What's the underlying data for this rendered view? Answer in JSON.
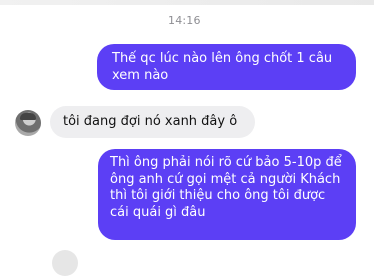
{
  "chat": {
    "timestamp": "14:16",
    "messages": [
      {
        "direction": "outgoing",
        "text": "Thế qc lúc nào lên ông chốt 1 câu xem nào"
      },
      {
        "direction": "incoming",
        "text": "tôi đang đợi nó xanh đây ô"
      },
      {
        "direction": "outgoing",
        "text": "Thì ông phải nói rõ cứ bảo 5-10p để ông anh cứ gọi mệt cả người Khách thì tôi giới thiệu cho ông tôi được cái quái gì đâu"
      }
    ]
  },
  "colors": {
    "outgoing_bubble": "#5c3ff5",
    "incoming_bubble": "#eeeef0",
    "timestamp_text": "#8e8e93"
  }
}
